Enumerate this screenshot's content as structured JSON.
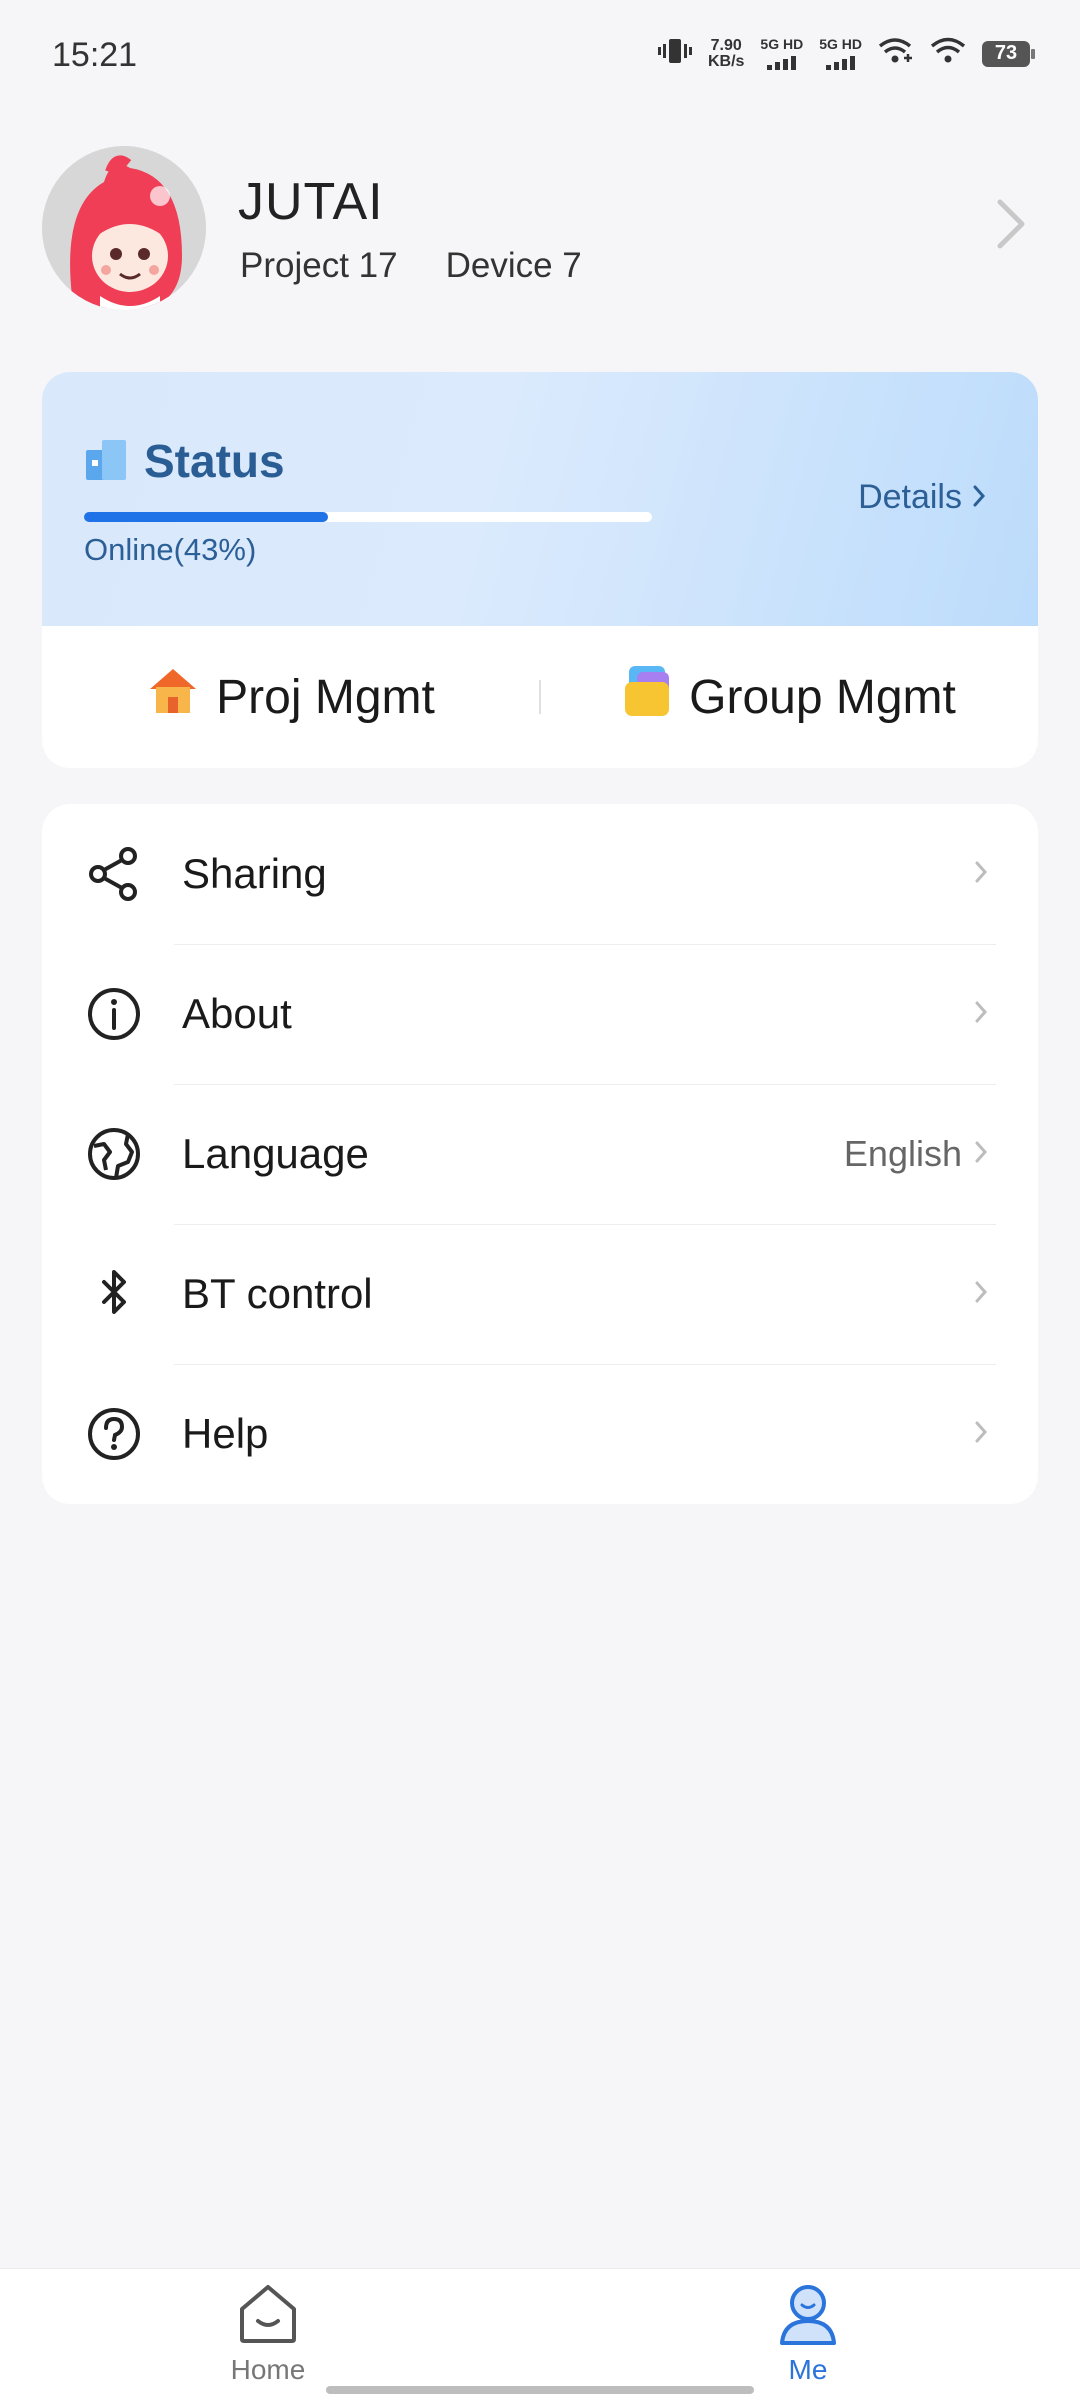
{
  "status_bar": {
    "time": "15:21",
    "net_speed_value": "7.90",
    "net_speed_unit": "KB/s",
    "sim1_label": "5G HD",
    "sim2_label": "5G HD",
    "battery": "73"
  },
  "profile": {
    "name": "JUTAI",
    "project": "Project 17",
    "device": "Device 7"
  },
  "status_card": {
    "title": "Status",
    "online_text": "Online(43%)",
    "online_progress_percent": 43,
    "details_label": "Details",
    "accent_color": "#1f73e6"
  },
  "quick_actions": [
    {
      "label": "Proj Mgmt",
      "icon": "house-icon"
    },
    {
      "label": "Group Mgmt",
      "icon": "folder-icon"
    }
  ],
  "menu": [
    {
      "label": "Sharing",
      "icon": "share-icon",
      "value": ""
    },
    {
      "label": "About",
      "icon": "info-icon",
      "value": ""
    },
    {
      "label": "Language",
      "icon": "globe-icon",
      "value": "English"
    },
    {
      "label": "BT control",
      "icon": "bluetooth-icon",
      "value": ""
    },
    {
      "label": "Help",
      "icon": "help-icon",
      "value": ""
    }
  ],
  "bottom_nav": {
    "home_label": "Home",
    "me_label": "Me",
    "active": "Me",
    "active_color": "#2a74db"
  }
}
